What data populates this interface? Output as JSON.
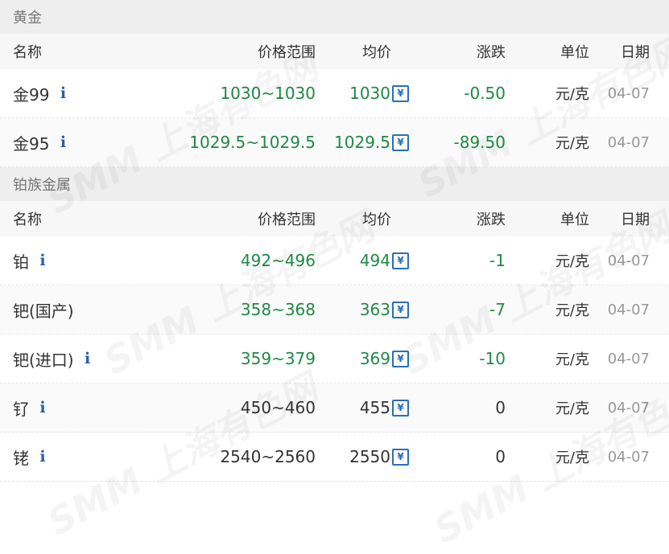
{
  "sections": [
    {
      "title": "黄金",
      "headers": {
        "name": "名称",
        "range": "价格范围",
        "avg": "均价",
        "change": "涨跌",
        "unit": "单位",
        "date": "日期"
      },
      "rows": [
        {
          "name": "金99",
          "info": "i",
          "range": "1030~1030",
          "avg": "1030",
          "change": "-0.50",
          "unit": "元/克",
          "date": "04-07"
        },
        {
          "name": "金95",
          "info": "i",
          "range": "1029.5~1029.5",
          "avg": "1029.5",
          "change": "-89.50",
          "unit": "元/克",
          "date": "04-07"
        }
      ]
    },
    {
      "title": "铂族金属",
      "headers": {
        "name": "名称",
        "range": "价格范围",
        "avg": "均价",
        "change": "涨跌",
        "unit": "单位",
        "date": "日期"
      },
      "rows": [
        {
          "name": "铂",
          "info": "i",
          "range": "492~496",
          "avg": "494",
          "change": "-1",
          "unit": "元/克",
          "date": "04-07"
        },
        {
          "name": "钯(国产)",
          "info": "",
          "range": "358~368",
          "avg": "363",
          "change": "-7",
          "unit": "元/克",
          "date": "04-07"
        },
        {
          "name": "钯(进口)",
          "info": "i",
          "range": "359~379",
          "avg": "369",
          "change": "-10",
          "unit": "元/克",
          "date": "04-07"
        },
        {
          "name": "钌",
          "info": "i",
          "range": "450~460",
          "avg": "455",
          "change": "0",
          "unit": "元/克",
          "date": "04-07"
        },
        {
          "name": "铑",
          "info": "i",
          "range": "2540~2560",
          "avg": "2550",
          "change": "0",
          "unit": "元/克",
          "date": "04-07"
        }
      ]
    }
  ],
  "yuan_glyph": "¥",
  "watermark_text": "SMM 上海有色网",
  "colors": {
    "up_down_green": "#1f8a45",
    "flat_dark": "#333333",
    "info_blue": "#2a5ea8",
    "yuan_icon_blue": "#2a6fb8"
  }
}
